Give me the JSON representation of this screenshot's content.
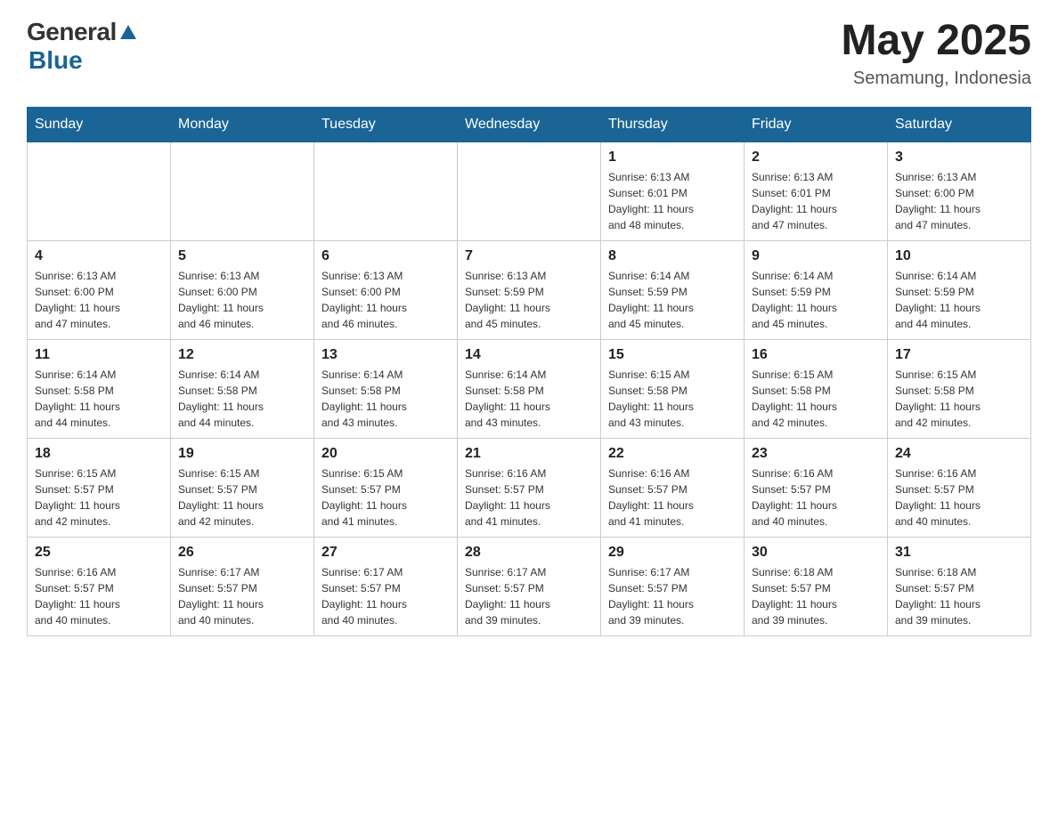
{
  "header": {
    "logo_general": "General",
    "logo_blue": "Blue",
    "month_year": "May 2025",
    "location": "Semamung, Indonesia"
  },
  "weekdays": [
    "Sunday",
    "Monday",
    "Tuesday",
    "Wednesday",
    "Thursday",
    "Friday",
    "Saturday"
  ],
  "weeks": [
    [
      {
        "day": "",
        "info": ""
      },
      {
        "day": "",
        "info": ""
      },
      {
        "day": "",
        "info": ""
      },
      {
        "day": "",
        "info": ""
      },
      {
        "day": "1",
        "info": "Sunrise: 6:13 AM\nSunset: 6:01 PM\nDaylight: 11 hours\nand 48 minutes."
      },
      {
        "day": "2",
        "info": "Sunrise: 6:13 AM\nSunset: 6:01 PM\nDaylight: 11 hours\nand 47 minutes."
      },
      {
        "day": "3",
        "info": "Sunrise: 6:13 AM\nSunset: 6:00 PM\nDaylight: 11 hours\nand 47 minutes."
      }
    ],
    [
      {
        "day": "4",
        "info": "Sunrise: 6:13 AM\nSunset: 6:00 PM\nDaylight: 11 hours\nand 47 minutes."
      },
      {
        "day": "5",
        "info": "Sunrise: 6:13 AM\nSunset: 6:00 PM\nDaylight: 11 hours\nand 46 minutes."
      },
      {
        "day": "6",
        "info": "Sunrise: 6:13 AM\nSunset: 6:00 PM\nDaylight: 11 hours\nand 46 minutes."
      },
      {
        "day": "7",
        "info": "Sunrise: 6:13 AM\nSunset: 5:59 PM\nDaylight: 11 hours\nand 45 minutes."
      },
      {
        "day": "8",
        "info": "Sunrise: 6:14 AM\nSunset: 5:59 PM\nDaylight: 11 hours\nand 45 minutes."
      },
      {
        "day": "9",
        "info": "Sunrise: 6:14 AM\nSunset: 5:59 PM\nDaylight: 11 hours\nand 45 minutes."
      },
      {
        "day": "10",
        "info": "Sunrise: 6:14 AM\nSunset: 5:59 PM\nDaylight: 11 hours\nand 44 minutes."
      }
    ],
    [
      {
        "day": "11",
        "info": "Sunrise: 6:14 AM\nSunset: 5:58 PM\nDaylight: 11 hours\nand 44 minutes."
      },
      {
        "day": "12",
        "info": "Sunrise: 6:14 AM\nSunset: 5:58 PM\nDaylight: 11 hours\nand 44 minutes."
      },
      {
        "day": "13",
        "info": "Sunrise: 6:14 AM\nSunset: 5:58 PM\nDaylight: 11 hours\nand 43 minutes."
      },
      {
        "day": "14",
        "info": "Sunrise: 6:14 AM\nSunset: 5:58 PM\nDaylight: 11 hours\nand 43 minutes."
      },
      {
        "day": "15",
        "info": "Sunrise: 6:15 AM\nSunset: 5:58 PM\nDaylight: 11 hours\nand 43 minutes."
      },
      {
        "day": "16",
        "info": "Sunrise: 6:15 AM\nSunset: 5:58 PM\nDaylight: 11 hours\nand 42 minutes."
      },
      {
        "day": "17",
        "info": "Sunrise: 6:15 AM\nSunset: 5:58 PM\nDaylight: 11 hours\nand 42 minutes."
      }
    ],
    [
      {
        "day": "18",
        "info": "Sunrise: 6:15 AM\nSunset: 5:57 PM\nDaylight: 11 hours\nand 42 minutes."
      },
      {
        "day": "19",
        "info": "Sunrise: 6:15 AM\nSunset: 5:57 PM\nDaylight: 11 hours\nand 42 minutes."
      },
      {
        "day": "20",
        "info": "Sunrise: 6:15 AM\nSunset: 5:57 PM\nDaylight: 11 hours\nand 41 minutes."
      },
      {
        "day": "21",
        "info": "Sunrise: 6:16 AM\nSunset: 5:57 PM\nDaylight: 11 hours\nand 41 minutes."
      },
      {
        "day": "22",
        "info": "Sunrise: 6:16 AM\nSunset: 5:57 PM\nDaylight: 11 hours\nand 41 minutes."
      },
      {
        "day": "23",
        "info": "Sunrise: 6:16 AM\nSunset: 5:57 PM\nDaylight: 11 hours\nand 40 minutes."
      },
      {
        "day": "24",
        "info": "Sunrise: 6:16 AM\nSunset: 5:57 PM\nDaylight: 11 hours\nand 40 minutes."
      }
    ],
    [
      {
        "day": "25",
        "info": "Sunrise: 6:16 AM\nSunset: 5:57 PM\nDaylight: 11 hours\nand 40 minutes."
      },
      {
        "day": "26",
        "info": "Sunrise: 6:17 AM\nSunset: 5:57 PM\nDaylight: 11 hours\nand 40 minutes."
      },
      {
        "day": "27",
        "info": "Sunrise: 6:17 AM\nSunset: 5:57 PM\nDaylight: 11 hours\nand 40 minutes."
      },
      {
        "day": "28",
        "info": "Sunrise: 6:17 AM\nSunset: 5:57 PM\nDaylight: 11 hours\nand 39 minutes."
      },
      {
        "day": "29",
        "info": "Sunrise: 6:17 AM\nSunset: 5:57 PM\nDaylight: 11 hours\nand 39 minutes."
      },
      {
        "day": "30",
        "info": "Sunrise: 6:18 AM\nSunset: 5:57 PM\nDaylight: 11 hours\nand 39 minutes."
      },
      {
        "day": "31",
        "info": "Sunrise: 6:18 AM\nSunset: 5:57 PM\nDaylight: 11 hours\nand 39 minutes."
      }
    ]
  ]
}
